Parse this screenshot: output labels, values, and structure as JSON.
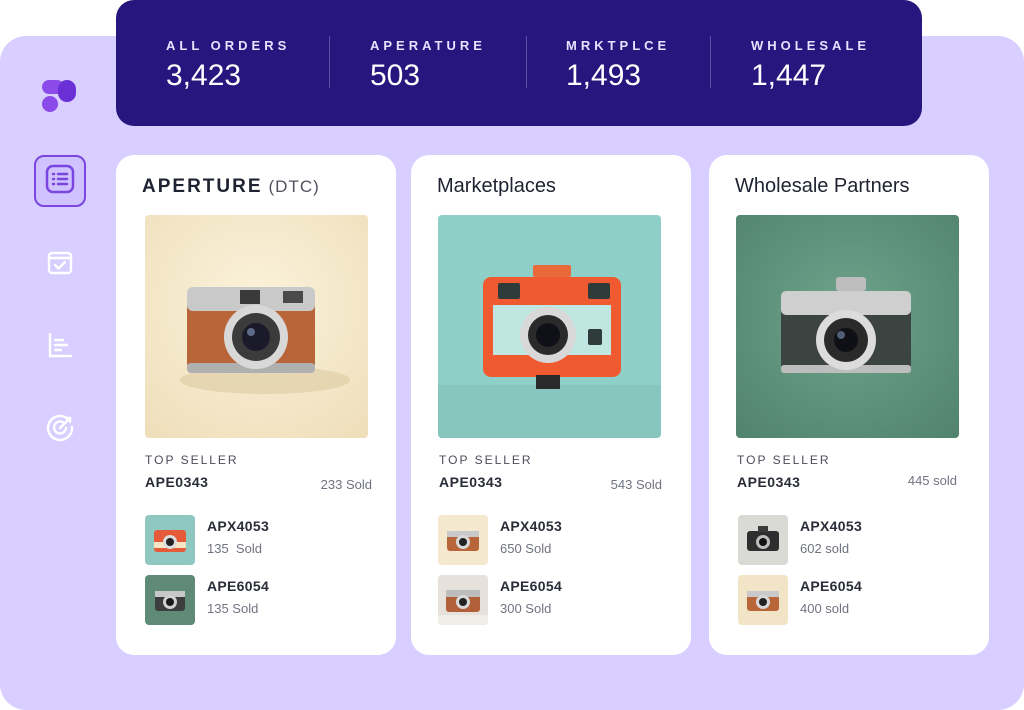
{
  "stats": [
    {
      "label": "ALL ORDERS",
      "value": "3,423"
    },
    {
      "label": "APERATURE",
      "value": "503"
    },
    {
      "label": "MRKTPLCE",
      "value": "1,493"
    },
    {
      "label": "WHOLESALE",
      "value": "1,447"
    }
  ],
  "sidebar": {
    "logo": "brand-logo-icon",
    "items": [
      {
        "icon": "list-icon",
        "active": true
      },
      {
        "icon": "box-check-icon",
        "active": false
      },
      {
        "icon": "bar-chart-icon",
        "active": false
      },
      {
        "icon": "target-icon",
        "active": false
      }
    ]
  },
  "cards": [
    {
      "title_brand": "APERTURE",
      "title_sub": "(DTC)",
      "top_label": "TOP SELLER",
      "top_sku": "APE0343",
      "top_sold": "233 Sold",
      "items": [
        {
          "sku": "APX4053",
          "sold": "135  Sold"
        },
        {
          "sku": "APE6054",
          "sold": "135 Sold"
        }
      ]
    },
    {
      "title": "Marketplaces",
      "top_label": "TOP SELLER",
      "top_sku": "APE0343",
      "top_sold": "543 Sold",
      "items": [
        {
          "sku": "APX4053",
          "sold": "650 Sold"
        },
        {
          "sku": "APE6054",
          "sold": "300 Sold"
        }
      ]
    },
    {
      "title": "Wholesale Partners",
      "top_label": "TOP SELLER",
      "top_sku": "APE0343",
      "top_sold": "445 sold",
      "items": [
        {
          "sku": "APX4053",
          "sold": "602 sold"
        },
        {
          "sku": "APE6054",
          "sold": "400 sold"
        }
      ]
    }
  ],
  "colors": {
    "accent": "#7b45e0",
    "stats_bg": "#26167e",
    "frame_bg": "#d8ceff"
  }
}
